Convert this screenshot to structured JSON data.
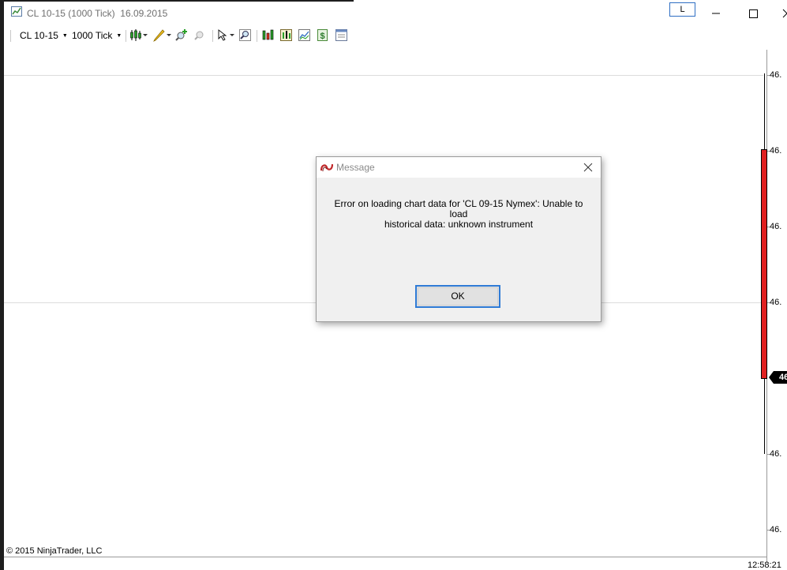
{
  "window": {
    "title": "CL 10-15 (1000 Tick)  16.09.2015",
    "link_button": "L",
    "colors": {
      "accent": "#2f6fc3",
      "candle_down": "#e02020"
    }
  },
  "toolbar": {
    "instrument": "CL 10-15",
    "interval": "1000 Tick",
    "icons": [
      "bar-type-icon",
      "drawing-tool-icon",
      "zoom-in-icon",
      "zoom-out-icon",
      "cursor-icon",
      "magnifier-icon",
      "indicators-icon",
      "strategies-icon",
      "chart-trader-icon",
      "dollar-icon",
      "properties-icon"
    ]
  },
  "chart": {
    "price_labels": [
      "46.",
      "46.",
      "46.",
      "46.",
      "46.",
      "46.",
      "46."
    ],
    "last_price": "46.",
    "time_label": "12:58:21",
    "copyright": "© 2015 NinjaTrader, LLC"
  },
  "dialog": {
    "title": "Message",
    "message_line1": "Error on loading chart data for 'CL 09-15 Nymex': Unable to load",
    "message_line2": "historical data: unknown instrument",
    "ok_label": "OK"
  }
}
